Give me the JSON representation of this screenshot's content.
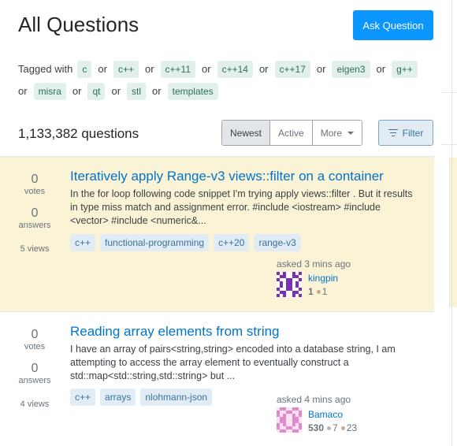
{
  "header": {
    "title": "All Questions",
    "ask_button": "Ask Question"
  },
  "tagged": {
    "label": "Tagged with",
    "or": "or",
    "tags": [
      "c",
      "c++",
      "c++11",
      "c++14",
      "c++17",
      "eigen3",
      "g++",
      "misra",
      "qt",
      "stl",
      "templates"
    ]
  },
  "summary": {
    "count": "1,133,382 questions"
  },
  "sort": {
    "options": [
      "Newest",
      "Active",
      "More"
    ],
    "selected": "Newest"
  },
  "filter_label": "Filter",
  "questions": [
    {
      "votes": "0",
      "votes_label": "votes",
      "answers": "0",
      "answers_label": "answers",
      "views": "5 views",
      "title": "Iteratively apply Range-v3 views::filter on a container",
      "excerpt": "In the for loop following code snippet I'm trying apply views::filter . But it results in type miss match and assignment error. #include <iostream> #include <vector> #include <numeric&...",
      "tags": [
        "c++",
        "functional-programming",
        "c++20",
        "range-v3"
      ],
      "asked": "asked 3 mins ago",
      "user": "kingpin",
      "reputation": "1",
      "bronze": "1",
      "highlighted": true
    },
    {
      "votes": "0",
      "votes_label": "votes",
      "answers": "0",
      "answers_label": "answers",
      "views": "4 views",
      "title": "Reading array elements from string",
      "excerpt": "I have an array of pairs<string,string> encoded into a database string, I am attempting to access the array element to eventually construct a std::map<std::string,std::string> but ...",
      "tags": [
        "c++",
        "arrays",
        "nlohmann-json"
      ],
      "asked": "asked 4 mins ago",
      "user": "Bamaco",
      "reputation": "530",
      "silver": "7",
      "bronze": "23",
      "highlighted": false
    }
  ],
  "colors": {
    "accent": "#0a95ff",
    "link": "#0074cc",
    "highlight": "#fbf3d5",
    "tag_bg": "#e1ecf4",
    "tag_text": "#39739d"
  }
}
